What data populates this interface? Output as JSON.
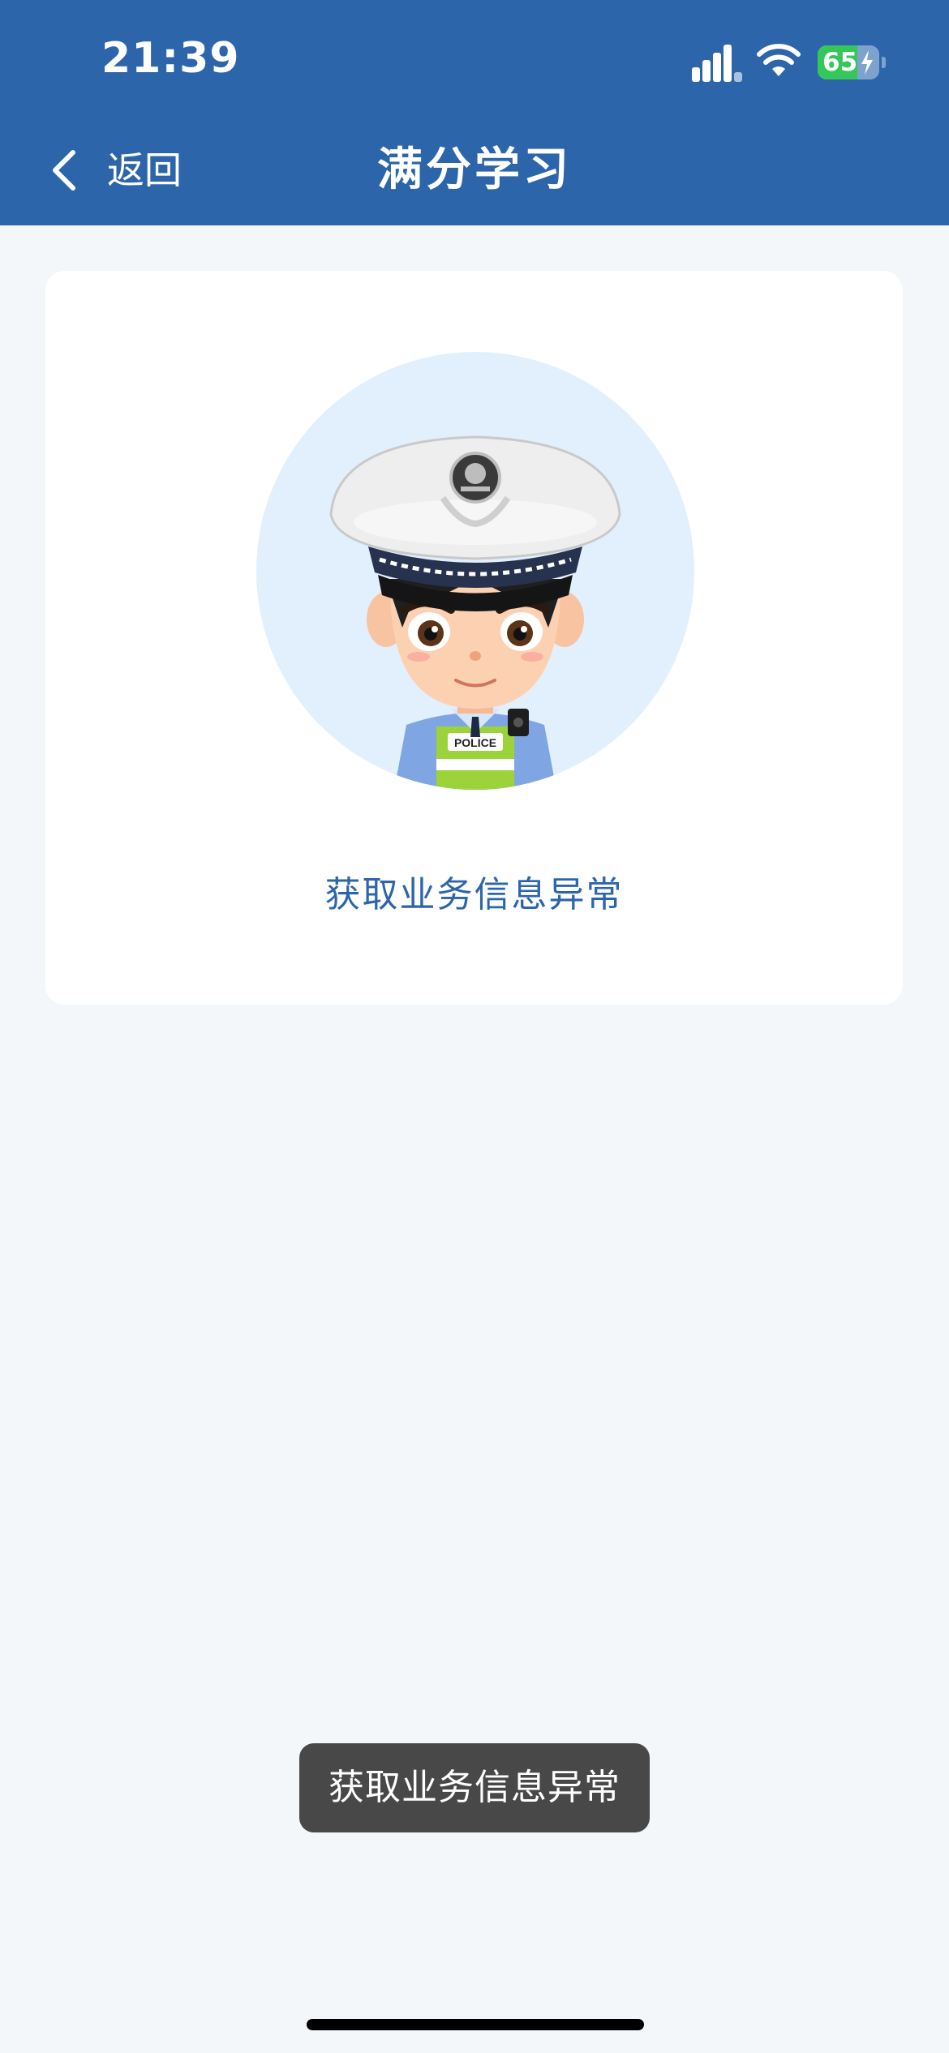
{
  "status_bar": {
    "time": "21:39",
    "battery_text": "65",
    "battery_level": 0.65,
    "icons": [
      "signal-icon",
      "wifi-icon",
      "battery-charging-icon"
    ]
  },
  "nav": {
    "back_label": "返回",
    "back_icon": "chevron-left-icon",
    "title": "满分学习"
  },
  "card": {
    "illustration": "police-officer-avatar",
    "message": "获取业务信息异常",
    "badge_text": "POLICE"
  },
  "toast": {
    "text": "获取业务信息异常"
  },
  "colors": {
    "header": "#2c65aa",
    "background": "#f3f7f9",
    "card": "#ffffff",
    "accent_text": "#2c65aa",
    "toast": "#484848",
    "battery": "#35c759"
  }
}
